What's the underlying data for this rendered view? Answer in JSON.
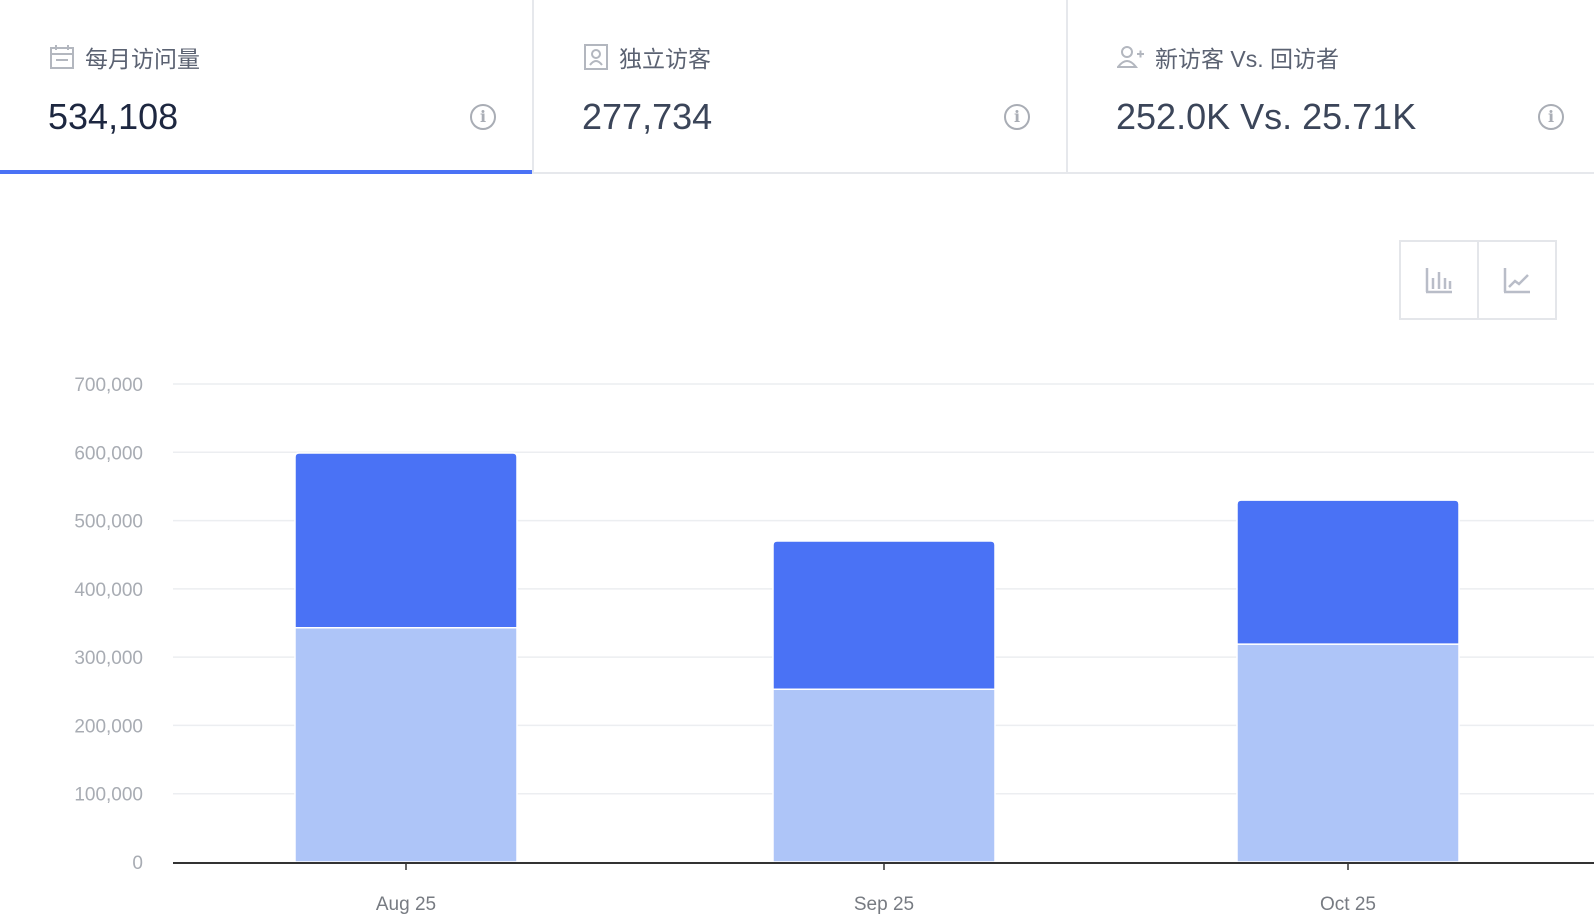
{
  "cards": [
    {
      "title": "每月访问量",
      "value": "534,108",
      "icon": "calendar-icon",
      "active": true
    },
    {
      "title": "独立访客",
      "value": "277,734",
      "icon": "id-badge-icon",
      "active": false
    },
    {
      "title": "新访客 Vs. 回访者",
      "value": "252.0K Vs. 25.71K",
      "icon": "user-add-icon",
      "active": false
    }
  ],
  "info_glyph": "i",
  "chart_toggle": {
    "options": [
      "bar-chart-icon",
      "line-chart-icon"
    ]
  },
  "colors": {
    "accent": "#4a72f5",
    "dark_series": "#4a72f5",
    "light_series": "#aec5f8"
  },
  "chart_data": {
    "type": "bar",
    "stacked": true,
    "categories": [
      "Aug 25",
      "Sep 25",
      "Oct 25"
    ],
    "series": [
      {
        "values": [
          343000,
          253000,
          319000
        ],
        "color": "#aec5f8"
      },
      {
        "values": [
          256000,
          217000,
          211000
        ],
        "color": "#4a72f5"
      }
    ],
    "yticks": [
      "0",
      "100,000",
      "200,000",
      "300,000",
      "400,000",
      "500,000",
      "600,000",
      "700,000"
    ],
    "ylim": [
      0,
      700000
    ],
    "grid": true,
    "title": "",
    "xlabel": "",
    "ylabel": ""
  }
}
